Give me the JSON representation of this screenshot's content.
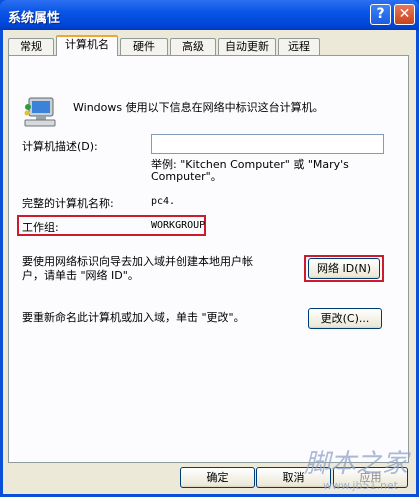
{
  "window": {
    "title": "系统属性",
    "help_button": "?",
    "close_button": "✕"
  },
  "tabs": [
    {
      "label": "常规"
    },
    {
      "label": "计算机名"
    },
    {
      "label": "硬件"
    },
    {
      "label": "高级"
    },
    {
      "label": "自动更新"
    },
    {
      "label": "远程"
    }
  ],
  "active_tab": "计算机名",
  "panel": {
    "intro": "Windows 使用以下信息在网络中标识这台计算机。",
    "desc_label": "计算机描述(D):",
    "desc_value": "",
    "example_line1": "举例: \"Kitchen Computer\" 或 \"Mary's",
    "example_line2": "Computer\"。",
    "fullname_label": "完整的计算机名称:",
    "fullname_value": "pc4.",
    "workgroup_label": "工作组:",
    "workgroup_value": "WORKGROUP",
    "wizard_text_line1": "要使用网络标识向导去加入域并创建本地用户帐",
    "wizard_text_line2": "户，请单击 \"网络 ID\"。",
    "network_id_button": "网络 ID(N)",
    "rename_text": "要重新命名此计算机或加入域，单击 \"更改\"。",
    "change_button": "更改(C)..."
  },
  "footer": {
    "ok_button": "确定",
    "cancel_button": "取消",
    "apply_button": "应用"
  },
  "watermark": {
    "main": "脚本之家",
    "sub": "www.jb51.net"
  },
  "colors": {
    "title_bar": "#0a55e6",
    "dialog_bg": "#ece9d8",
    "highlight_box": "#cc1b2b",
    "tab_accent": "#f1a535"
  }
}
